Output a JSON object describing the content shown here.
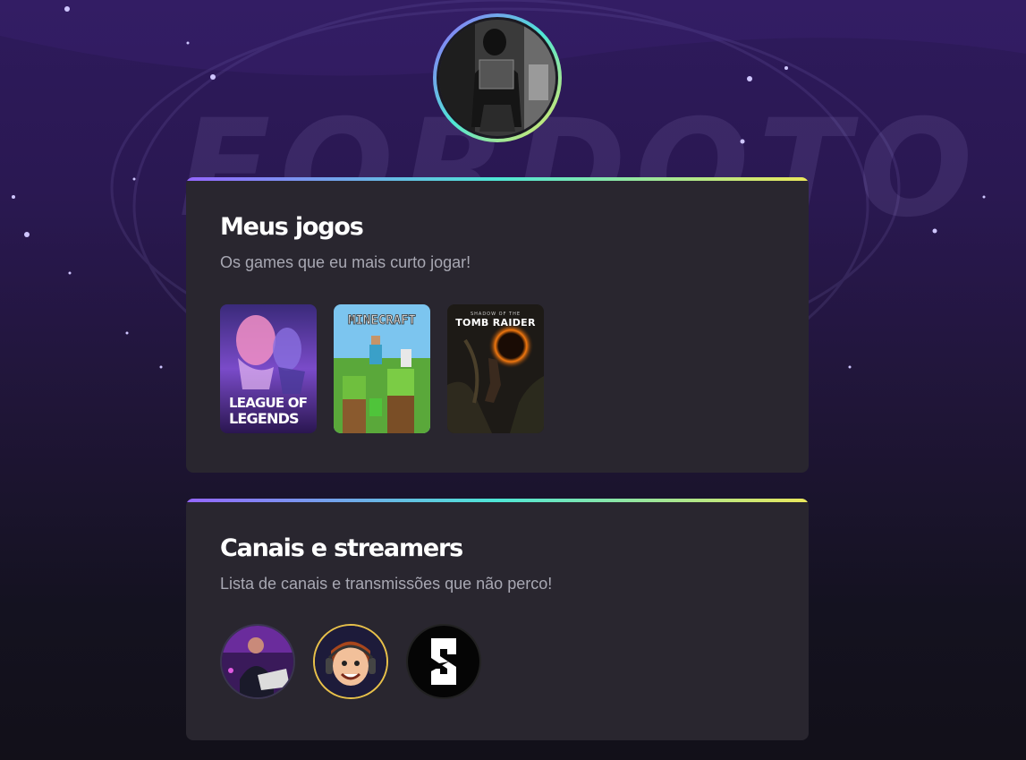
{
  "profile": {
    "avatar_label": "profile-photo"
  },
  "games_section": {
    "title": "Meus jogos",
    "subtitle": "Os games que eu mais curto jogar!",
    "items": [
      {
        "name": "League of Legends",
        "art_line1": "LEAGUE OF",
        "art_line2": "LEGENDS"
      },
      {
        "name": "Minecraft",
        "art_text": "MINECRAFT"
      },
      {
        "name": "Shadow of the Tomb Raider",
        "art_small": "SHADOW OF THE",
        "art_text": "TOMB RAIDER"
      }
    ]
  },
  "channels_section": {
    "title": "Canais e streamers",
    "subtitle": "Lista de canais e transmissões que não perco!",
    "items": [
      {
        "name": "channel-1"
      },
      {
        "name": "channel-2"
      },
      {
        "name": "channel-3"
      }
    ]
  },
  "colors": {
    "gradient_start": "#9466ff",
    "gradient_mid": "#4ee6d6",
    "gradient_end": "#ebe75b",
    "card_bg": "#29262f",
    "title": "#ffffff",
    "subtitle": "#a8a8b3"
  }
}
